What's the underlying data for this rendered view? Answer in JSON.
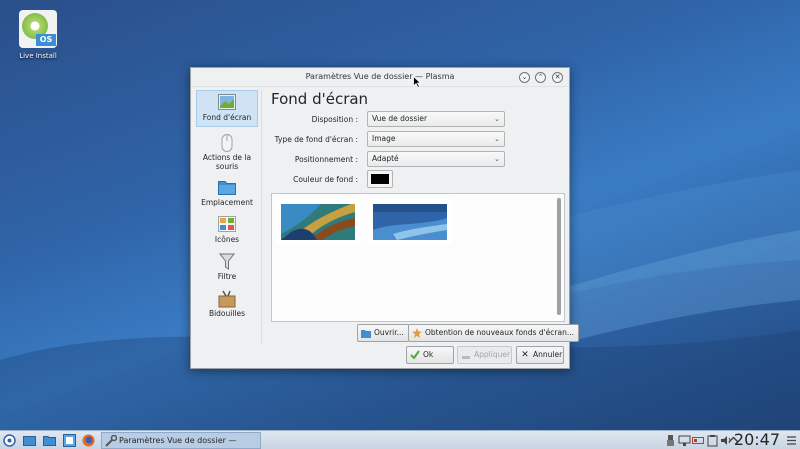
{
  "desktop": {
    "icon_label": "Live Install",
    "icon_badge": "OS"
  },
  "dialog": {
    "title": "Paramètres Vue de dossier — Plasma",
    "sidebar": [
      {
        "label": "Fond d'écran",
        "icon": "wallpaper-icon"
      },
      {
        "label": "Actions de la souris",
        "icon": "mouse-icon"
      },
      {
        "label": "Emplacement",
        "icon": "folder-icon"
      },
      {
        "label": "Icônes",
        "icon": "icons-icon"
      },
      {
        "label": "Filtre",
        "icon": "filter-icon"
      },
      {
        "label": "Bidouilles",
        "icon": "tweaks-icon"
      }
    ],
    "heading": "Fond d'écran",
    "form": {
      "layout_label": "Disposition :",
      "layout_value": "Vue de dossier",
      "type_label": "Type de fond d'écran :",
      "type_value": "Image",
      "position_label": "Positionnement :",
      "position_value": "Adapté",
      "color_label": "Couleur de fond :",
      "color_value": "#000000"
    },
    "buttons": {
      "open": "Ouvrir...",
      "get_new": "Obtention de nouveaux fonds d'écran...",
      "ok": "Ok",
      "apply": "Appliquer",
      "cancel": "Annuler"
    }
  },
  "taskbar": {
    "task_label": "Paramètres Vue de dossier — Plasma",
    "clock": "20:47"
  },
  "colors": {
    "accent": "#3daee9",
    "selection": "#cfe3f5"
  }
}
